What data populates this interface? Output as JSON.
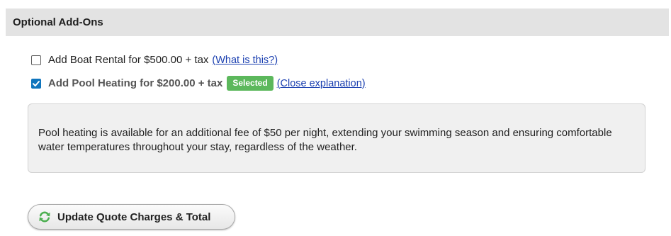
{
  "section": {
    "title": "Optional Add-Ons"
  },
  "addons": [
    {
      "label": "Add Boat Rental for $500.00 + tax",
      "checked": false,
      "link_text": "(What is this?)"
    },
    {
      "label": "Add Pool Heating for $200.00 + tax",
      "checked": true,
      "badge": "Selected",
      "link_text": "(Close explanation)"
    }
  ],
  "explanation": {
    "text": "Pool heating is available for an additional fee of $50 per night, extending your swimming season and ensuring comfortable water temperatures throughout your stay, regardless of the weather."
  },
  "update_button": {
    "label": "Update Quote Charges & Total",
    "icon": "refresh-icon"
  },
  "colors": {
    "header_background": "#e3e3e3",
    "checkbox_checked": "#0f75bd",
    "badge_green": "#5cb85c",
    "link_blue": "#1a3fb0",
    "refresh_icon_green": "#4caf50"
  }
}
